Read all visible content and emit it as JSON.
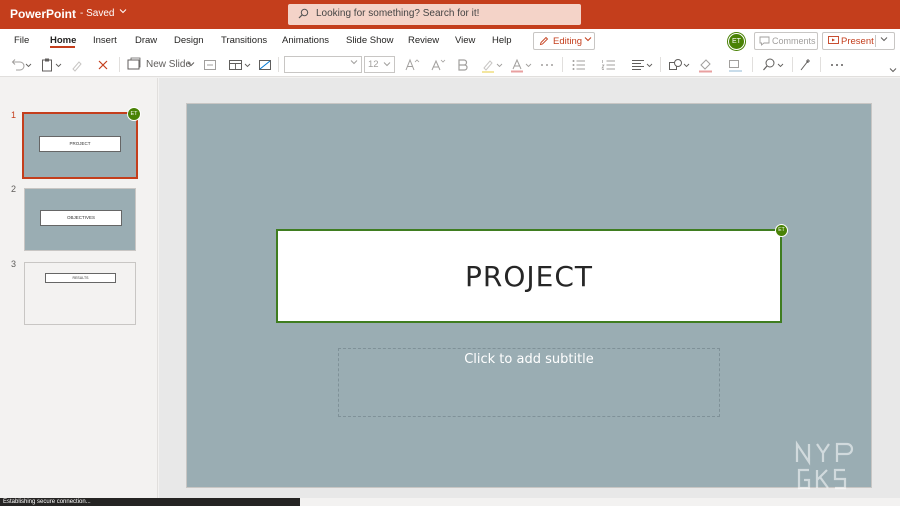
{
  "app": {
    "name": "PowerPoint",
    "saved_status": "- Saved",
    "search_placeholder": "Looking for something? Search for it!"
  },
  "ribbon": {
    "tabs": [
      {
        "label": "File"
      },
      {
        "label": "Home",
        "active": true
      },
      {
        "label": "Insert"
      },
      {
        "label": "Draw"
      },
      {
        "label": "Design"
      },
      {
        "label": "Transitions"
      },
      {
        "label": "Animations"
      },
      {
        "label": "Slide Show"
      },
      {
        "label": "Review"
      },
      {
        "label": "View"
      },
      {
        "label": "Help"
      }
    ],
    "editing_label": "Editing",
    "user_initials": "ET",
    "comments_label": "Comments",
    "present_label": "Present"
  },
  "toolbar": {
    "new_slide_label": "New Slide",
    "font_name": "",
    "font_size": "12"
  },
  "slides": [
    {
      "number": "1",
      "title": "PROJECT",
      "selected": true,
      "badge": "ET"
    },
    {
      "number": "2",
      "title": "OBJECTIVES"
    },
    {
      "number": "3",
      "title": "RESULTS"
    }
  ],
  "current_slide": {
    "title": "PROJECT",
    "subtitle_placeholder": "Click to add subtitle",
    "badge": "ET"
  },
  "status": {
    "text": "Establishing secure connection..."
  },
  "colors": {
    "brand": "#c43e1c",
    "slide_background": "#9aadb3",
    "selection_border": "#3f7d20",
    "avatar": "#498205"
  }
}
